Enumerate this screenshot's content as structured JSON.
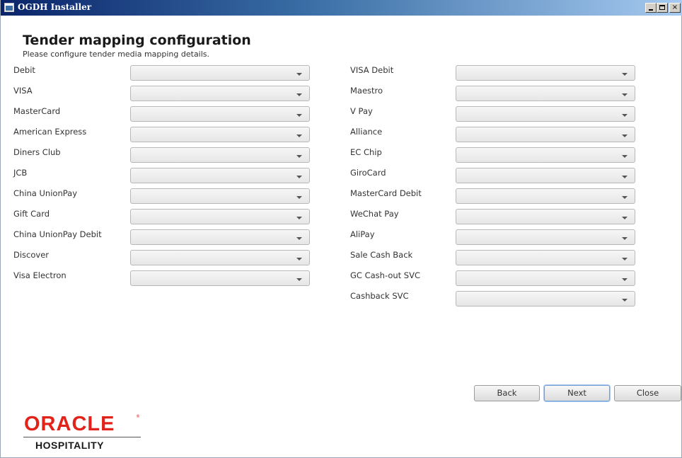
{
  "window": {
    "title": "OGDH Installer",
    "controls": {
      "minimize": "_",
      "maximize": "□",
      "close": "×"
    }
  },
  "page": {
    "title": "Tender mapping configuration",
    "subtitle": "Please configure tender media mapping details."
  },
  "tenders_left": [
    {
      "label": "Debit",
      "value": ""
    },
    {
      "label": "VISA",
      "value": ""
    },
    {
      "label": "MasterCard",
      "value": ""
    },
    {
      "label": "American Express",
      "value": ""
    },
    {
      "label": "Diners Club",
      "value": ""
    },
    {
      "label": "JCB",
      "value": ""
    },
    {
      "label": "China UnionPay",
      "value": ""
    },
    {
      "label": "Gift Card",
      "value": ""
    },
    {
      "label": "China UnionPay Debit",
      "value": ""
    },
    {
      "label": "Discover",
      "value": ""
    },
    {
      "label": "Visa Electron",
      "value": ""
    }
  ],
  "tenders_right": [
    {
      "label": "VISA Debit",
      "value": ""
    },
    {
      "label": "Maestro",
      "value": ""
    },
    {
      "label": "V Pay",
      "value": ""
    },
    {
      "label": "Alliance",
      "value": ""
    },
    {
      "label": "EC Chip",
      "value": ""
    },
    {
      "label": "GiroCard",
      "value": ""
    },
    {
      "label": "MasterCard Debit",
      "value": ""
    },
    {
      "label": "WeChat Pay",
      "value": ""
    },
    {
      "label": "AliPay",
      "value": ""
    },
    {
      "label": "Sale Cash Back",
      "value": ""
    },
    {
      "label": "GC Cash-out SVC",
      "value": ""
    },
    {
      "label": "Cashback SVC",
      "value": ""
    }
  ],
  "buttons": {
    "back": "Back",
    "next": "Next",
    "close": "Close"
  },
  "logo": {
    "brand": "ORACLE",
    "reg": "®",
    "product": "HOSPITALITY"
  },
  "colors": {
    "brand_red": "#e2231a",
    "titlebar": "#0a246a",
    "focus_border": "#6f9fd8"
  }
}
